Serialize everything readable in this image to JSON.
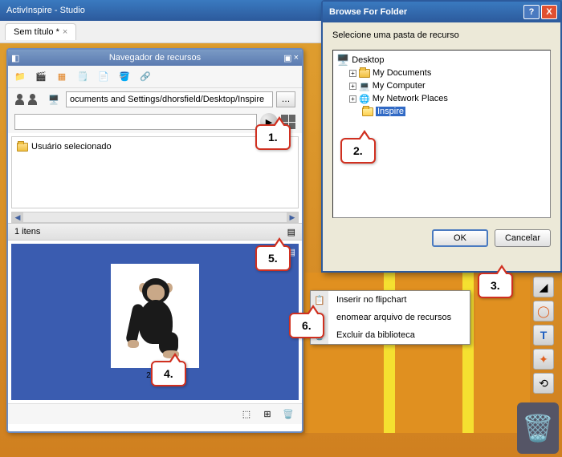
{
  "main_window": {
    "title": "ActivInspire - Studio"
  },
  "tabs": {
    "doc_title": "Sem título *"
  },
  "resource_panel": {
    "title": "Navegador de recursos",
    "path": "ocuments and Settings/dhorsfield/Desktop/Inspire",
    "browse_btn": "…",
    "tree_item": "Usuário selecionado",
    "items_count": "1 itens",
    "thumb_label": "2.jpg"
  },
  "context_menu": {
    "insert": "Inserir no flipchart",
    "rename": "enomear arquivo de recursos",
    "delete": "Excluir da biblioteca"
  },
  "browse_dialog": {
    "title": "Browse For Folder",
    "instruction": "Selecione uma pasta de recurso",
    "tree": {
      "desktop": "Desktop",
      "my_documents": "My Documents",
      "my_computer": "My Computer",
      "my_network": "My Network Places",
      "inspire": "Inspire"
    },
    "ok": "OK",
    "cancel": "Cancelar"
  },
  "callouts": {
    "c1": "1.",
    "c2": "2.",
    "c3": "3.",
    "c4": "4.",
    "c5": "5.",
    "c6": "6."
  }
}
